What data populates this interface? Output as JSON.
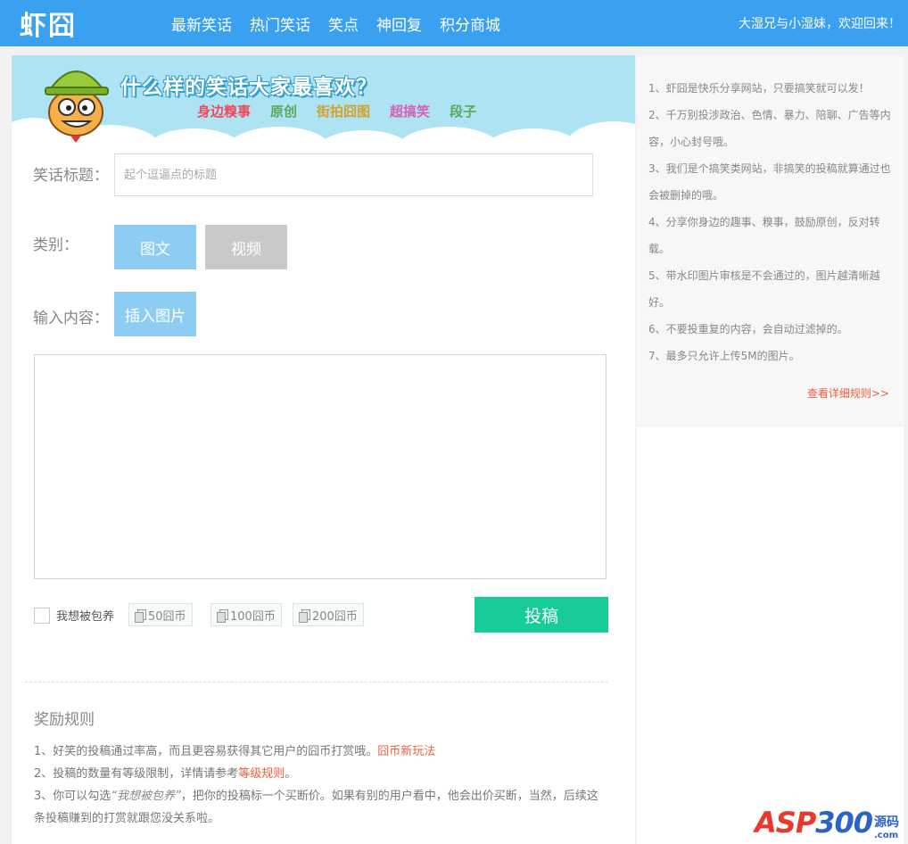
{
  "header": {
    "logo": "虾囧",
    "nav": [
      "最新笑话",
      "热门笑话",
      "笑点",
      "神回复",
      "积分商城"
    ],
    "welcome": "大湿兄与小湿妹，欢迎回来！"
  },
  "banner": {
    "headline": "什么样的笑话大家最喜欢？",
    "tags": [
      {
        "text": "身边糗事",
        "color": "#ee4a5a"
      },
      {
        "text": "原创",
        "color": "#5aa85a"
      },
      {
        "text": "街拍囧图",
        "color": "#d4a02a"
      },
      {
        "text": "超搞笑",
        "color": "#d85fb5"
      },
      {
        "text": "段子",
        "color": "#5aa85a"
      }
    ]
  },
  "form": {
    "title_label": "笑话标题：",
    "title_placeholder": "起个逗逼点的标题",
    "category_label": "类别：",
    "category_image_text": "图文",
    "category_video": "视频",
    "content_label": "输入内容：",
    "insert_image": "插入图片",
    "checkbox_label": "我想被包养",
    "coin_options": [
      "50囧币",
      "100囧币",
      "200囧币"
    ],
    "submit": "投稿"
  },
  "reward": {
    "title": "奖励规则",
    "item1_text": "1、好笑的投稿通过率高，而且更容易获得其它用户的囧币打赏哦。",
    "item1_link": "囧币新玩法",
    "item2_text": "2、投稿的数量有等级限制，详情请参考",
    "item2_link": "等级规则",
    "item2_end": "。",
    "item3_pre": "3、你可以勾选",
    "item3_quote": "“我想被包养”",
    "item3_post": "，把你的投稿标一个买断价。如果有别的用户看中，他会出价买断，当然，后续这条投稿赚到的打赏就跟您没关系啦。"
  },
  "side": {
    "rules": [
      "1、虾囧是快乐分享网站，只要搞笑就可以发！",
      "2、千万别投涉政治、色情、暴力、陪聊、广告等内容，小心封号哦。",
      "3、我们是个搞笑类网站，非搞笑的投稿就算通过也会被删掉的哦。",
      "4、分享你身边的趣事、糗事，鼓励原创，反对转载。",
      "5、带水印图片审核是不会通过的，图片越清晰越好。",
      "6、不要投重复的内容，会自动过滤掉的。",
      "7、最多只允许上传5M的图片。"
    ],
    "more": "查看详细规则>>"
  },
  "watermark": {
    "brand_a": "ASP",
    "brand_b": "300",
    "side": "源码",
    "domain": ".com"
  }
}
